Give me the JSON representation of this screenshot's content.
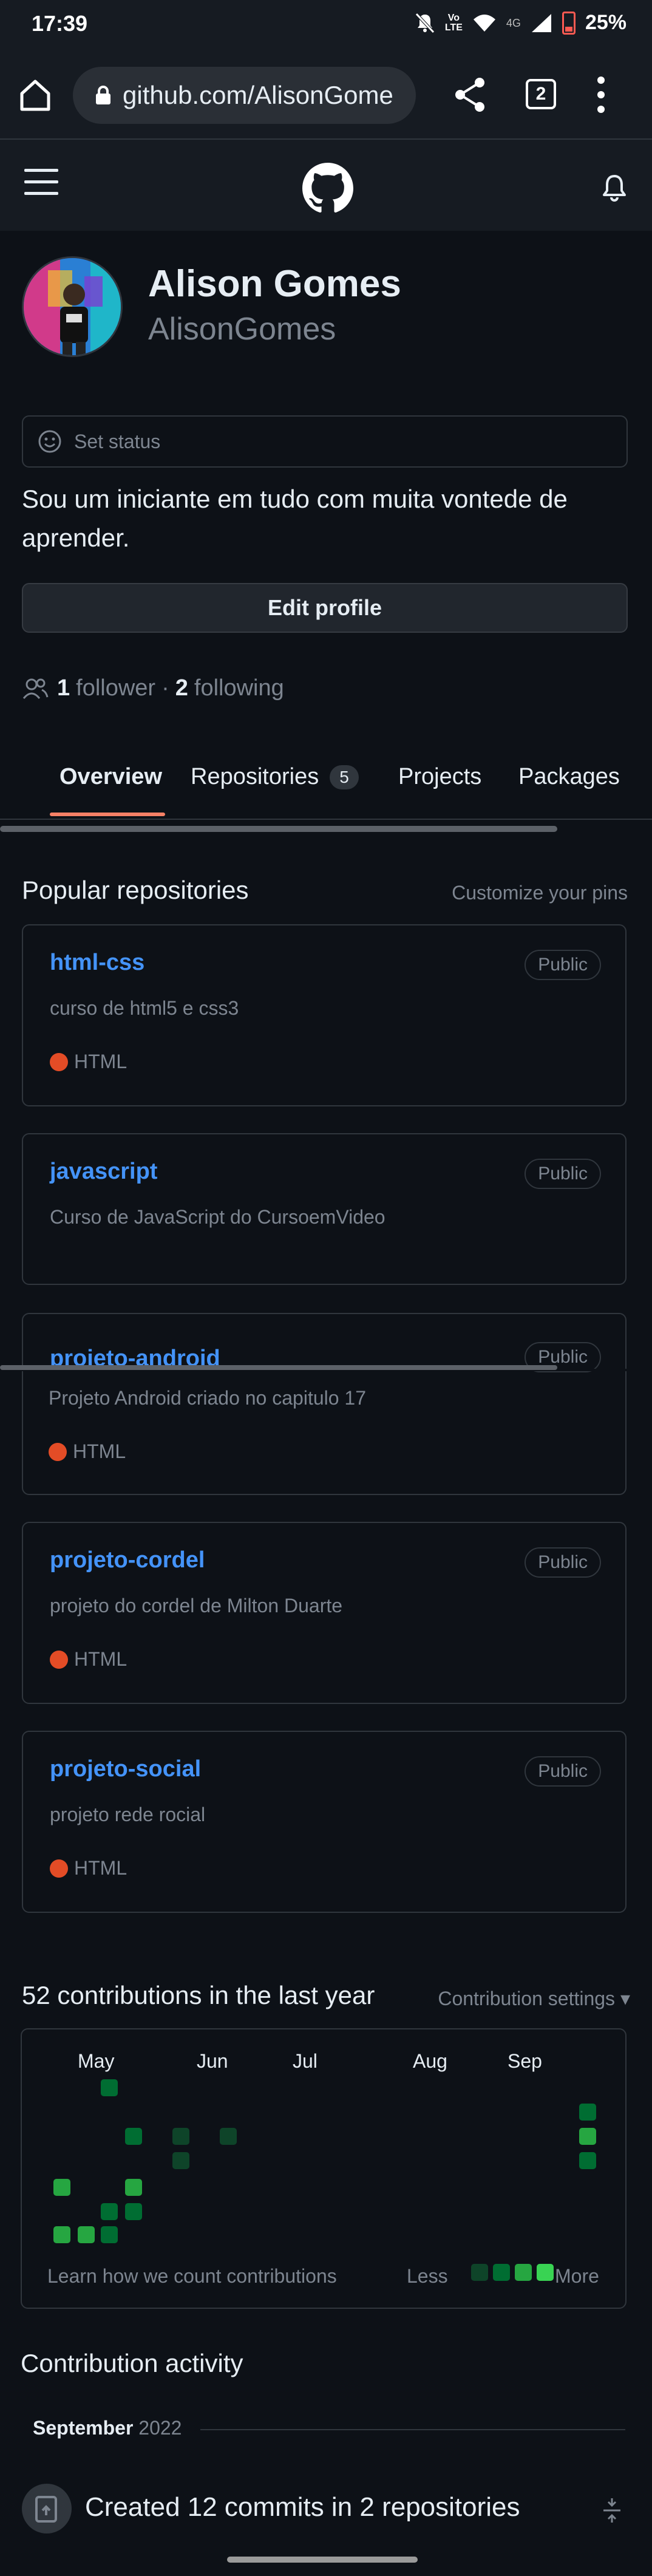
{
  "status_bar": {
    "time": "17:39",
    "volte_top": "Vo",
    "volte_bottom": "LTE",
    "network": "4G",
    "battery": "25%"
  },
  "browser": {
    "url": "github.com/AlisonGome",
    "tab_count": "2",
    "icons": [
      "home-icon",
      "lock-icon",
      "share-icon",
      "menu-dots-icon"
    ]
  },
  "header": {
    "icons": [
      "hamburger-icon",
      "github-logo-icon",
      "bell-icon"
    ]
  },
  "profile": {
    "full_name": "Alison Gomes",
    "username": "AlisonGomes",
    "set_status": "Set status",
    "bio": "Sou um iniciante em tudo com muita vontede de aprender.",
    "edit_profile": "Edit profile",
    "followers_count": "1",
    "followers_label": "follower",
    "separator": "·",
    "following_count": "2",
    "following_label": "following"
  },
  "tabs": [
    {
      "label": "Overview",
      "active": true
    },
    {
      "label": "Repositories",
      "count": "5"
    },
    {
      "label": "Projects"
    },
    {
      "label": "Packages"
    }
  ],
  "popular": {
    "title": "Popular repositories",
    "customize": "Customize your pins",
    "repos": [
      {
        "name": "html-css",
        "visibility": "Public",
        "description": "curso de html5 e css3",
        "language": "HTML"
      },
      {
        "name": "javascript",
        "visibility": "Public",
        "description": "Curso de JavaScript do CursoemVideo",
        "language": ""
      },
      {
        "name": "projeto-android",
        "visibility": "Public",
        "description": "Projeto Android criado no capitulo 17",
        "language": "HTML"
      },
      {
        "name": "projeto-cordel",
        "visibility": "Public",
        "description": "projeto do cordel de Milton Duarte",
        "language": "HTML"
      },
      {
        "name": "projeto-social",
        "visibility": "Public",
        "description": "projeto rede rocial",
        "language": "HTML"
      }
    ],
    "language_color": "#e34c26"
  },
  "contributions": {
    "title": "52 contributions in the last year",
    "settings": "Contribution settings",
    "months": [
      "May",
      "Jun",
      "Jul",
      "Aug",
      "Sep"
    ],
    "learn_link": "Learn how we count contributions",
    "less": "Less",
    "more": "More",
    "level_colors": [
      "#0e4429",
      "#006d32",
      "#26a641",
      "#39d353"
    ]
  },
  "activity": {
    "title": "Contribution activity",
    "month": "September",
    "year": "2022",
    "item": "Created 12 commits in 2 repositories"
  }
}
